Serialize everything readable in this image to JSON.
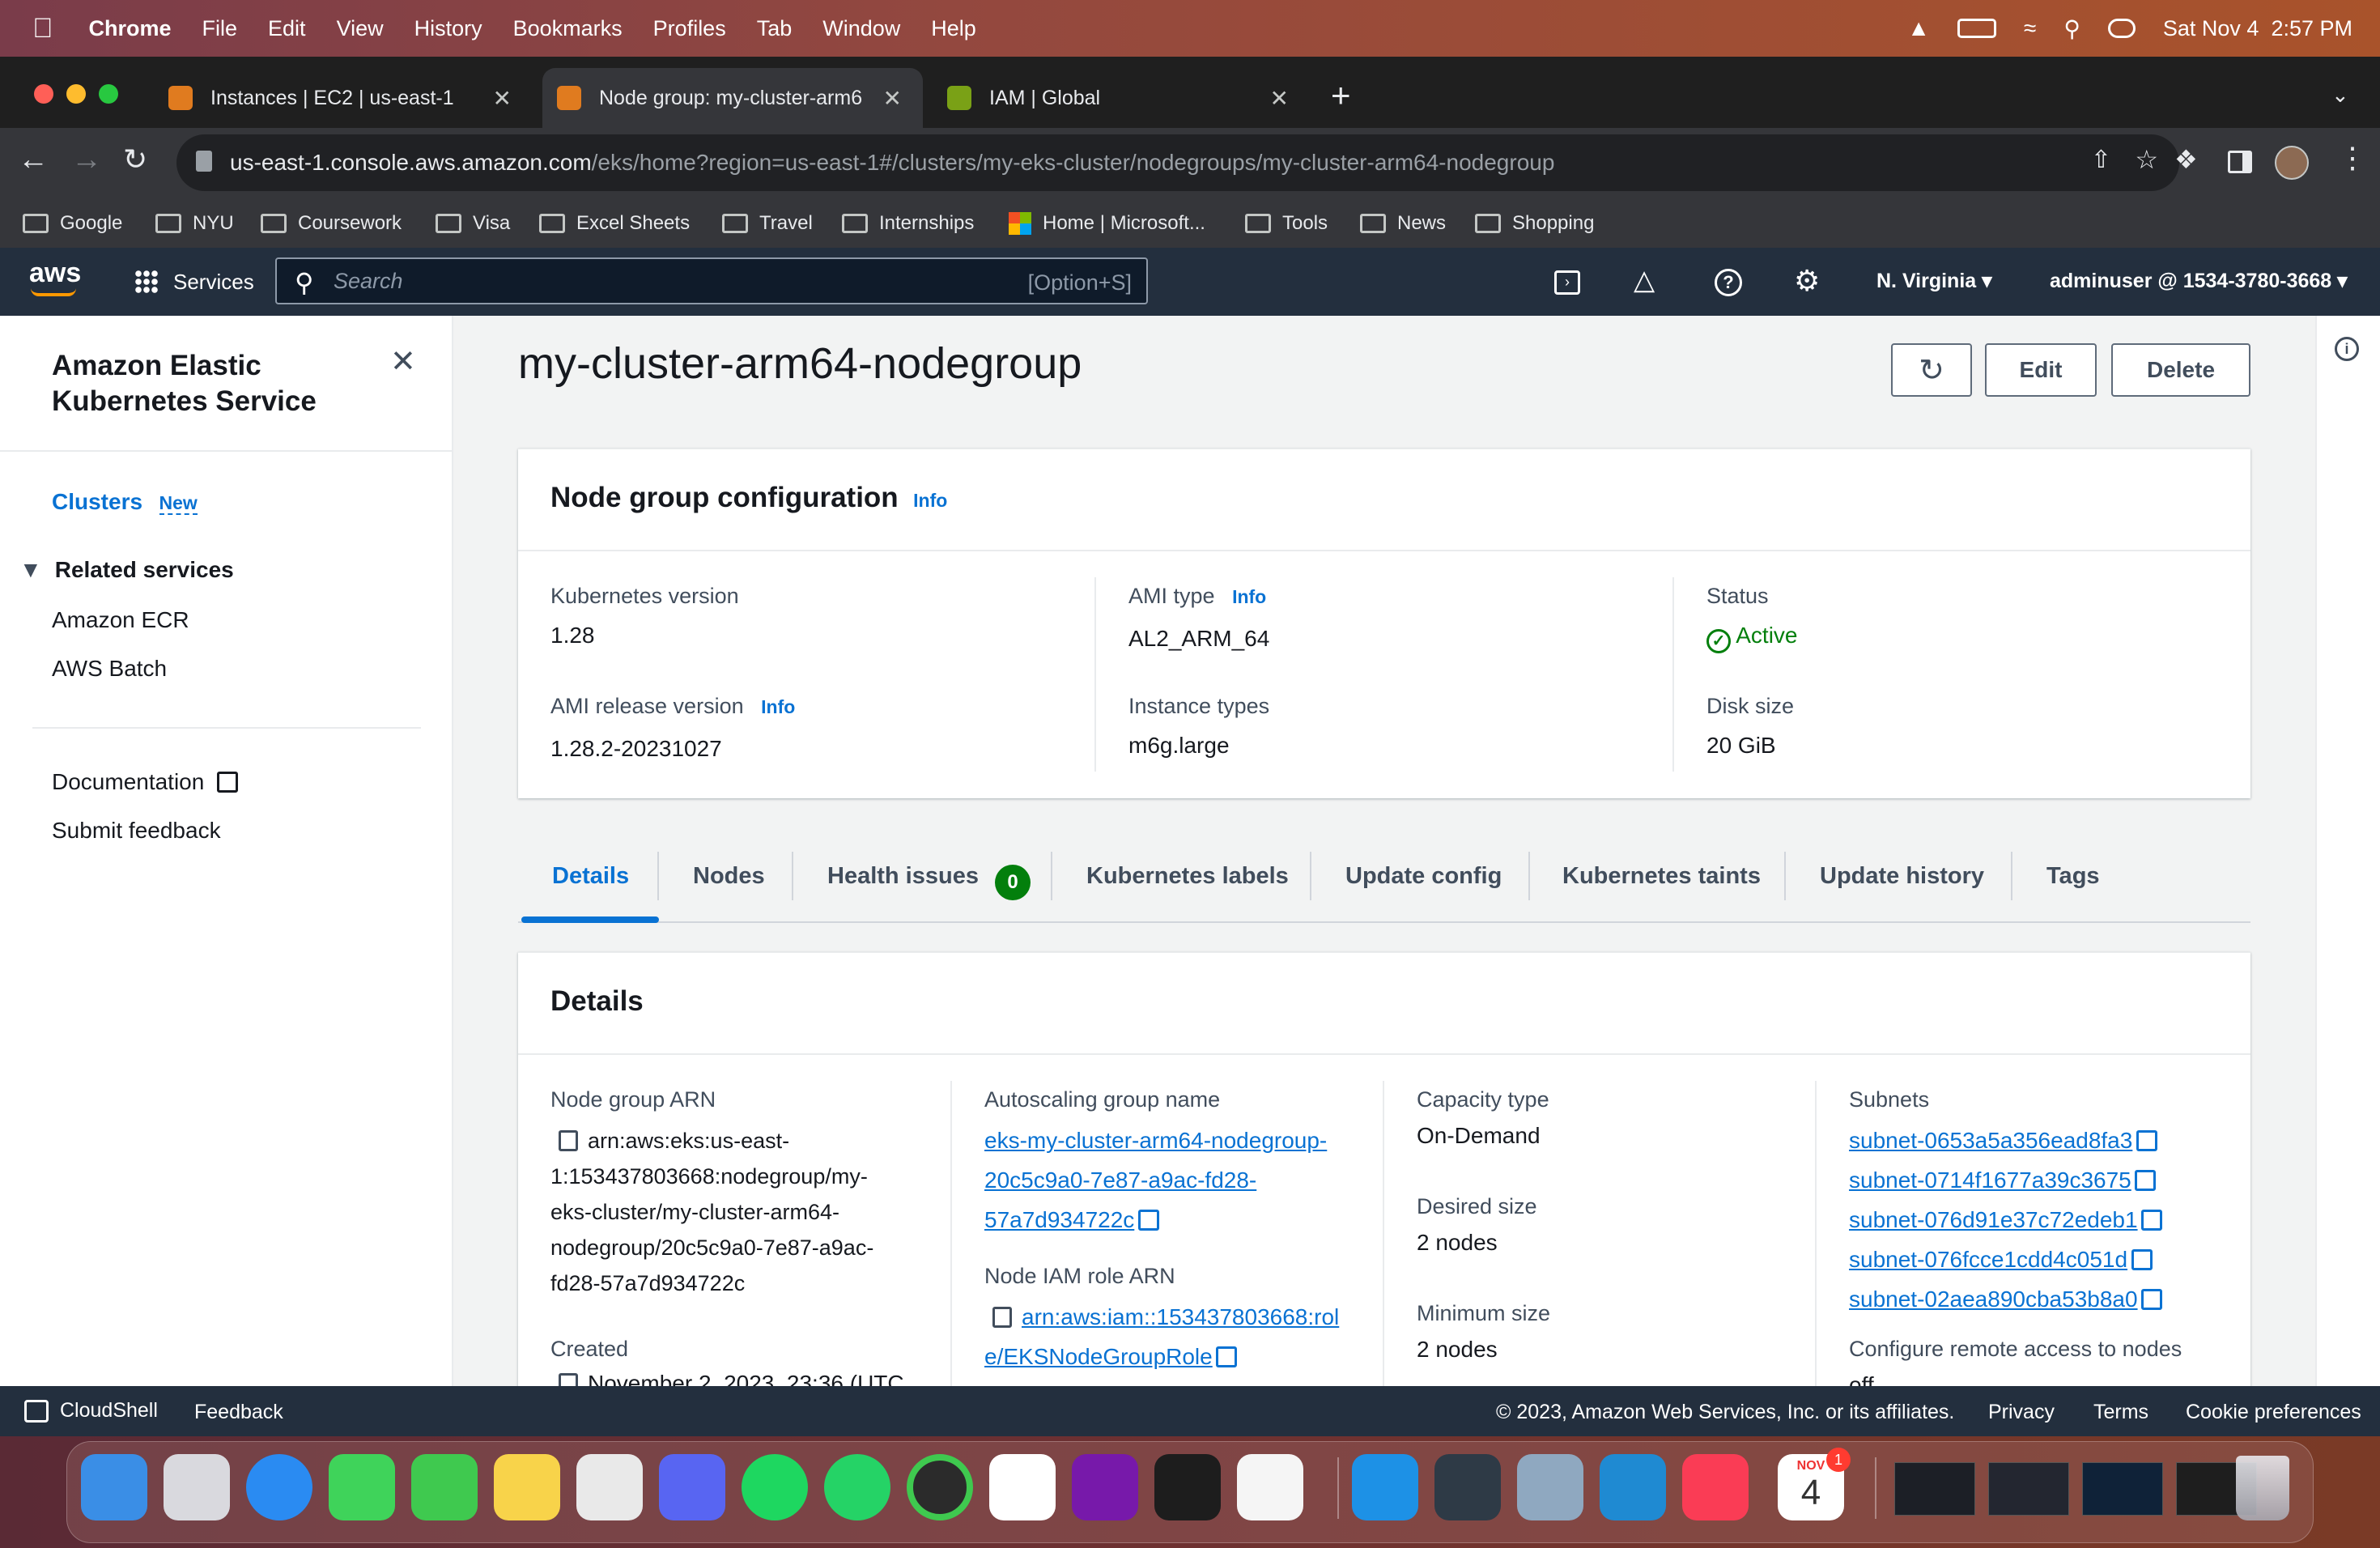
{
  "menubar": {
    "app": "Chrome",
    "items": [
      "File",
      "Edit",
      "View",
      "History",
      "Bookmarks",
      "Profiles",
      "Tab",
      "Window",
      "Help"
    ],
    "datetime": "Sat Nov 4  2:57 PM"
  },
  "browser": {
    "tabs": [
      {
        "title": "Instances | EC2 | us-east-1",
        "favicon_color": "#e07b1f"
      },
      {
        "title": "Node group: my-cluster-arm6",
        "favicon_color": "#e07b1f"
      },
      {
        "title": "IAM | Global",
        "favicon_color": "#7aa116"
      }
    ],
    "url_domain": "us-east-1.console.aws.amazon.com",
    "url_path": "/eks/home?region=us-east-1#/clusters/my-eks-cluster/nodegroups/my-cluster-arm64-nodegroup",
    "bookmarks": [
      "Google",
      "NYU",
      "Coursework",
      "Visa",
      "Excel Sheets",
      "Travel",
      "Internships",
      "Home | Microsoft...",
      "Tools",
      "News",
      "Shopping"
    ]
  },
  "awsnav": {
    "logo": "aws",
    "services": "Services",
    "search_placeholder": "Search",
    "search_shortcut": "[Option+S]",
    "region": "N. Virginia",
    "account": "adminuser @ 1534-3780-3668"
  },
  "sidebar": {
    "title": "Amazon Elastic Kubernetes Service",
    "clusters": "Clusters",
    "new_badge": "New",
    "related": "Related services",
    "related_items": [
      "Amazon ECR",
      "AWS Batch"
    ],
    "documentation": "Documentation",
    "feedback": "Submit feedback"
  },
  "page": {
    "title": "my-cluster-arm64-nodegroup",
    "edit": "Edit",
    "delete": "Delete"
  },
  "config": {
    "heading": "Node group configuration",
    "info": "Info",
    "k8s_version_label": "Kubernetes version",
    "k8s_version": "1.28",
    "ami_type_label": "AMI type",
    "ami_type": "AL2_ARM_64",
    "status_label": "Status",
    "status": "Active",
    "ami_release_label": "AMI release version",
    "ami_release": "1.28.2-20231027",
    "instance_types_label": "Instance types",
    "instance_types": "m6g.large",
    "disk_size_label": "Disk size",
    "disk_size": "20 GiB"
  },
  "tabs": {
    "items": [
      "Details",
      "Nodes",
      "Health issues",
      "Kubernetes labels",
      "Update config",
      "Kubernetes taints",
      "Update history",
      "Tags"
    ],
    "health_count": "0"
  },
  "details": {
    "heading": "Details",
    "arn_label": "Node group ARN",
    "arn_lines": [
      "arn:aws:eks:us-east-",
      "1:153437803668:nodegroup/my-",
      "eks-cluster/my-cluster-arm64-",
      "nodegroup/20c5c9a0-7e87-a9ac-",
      "fd28-57a7d934722c"
    ],
    "created_label": "Created",
    "created_value": "November 2, 2023, 23:36 (UTC",
    "asg_label": "Autoscaling group name",
    "asg_lines": [
      "eks-my-cluster-arm64-nodegroup-",
      "20c5c9a0-7e87-a9ac-fd28-",
      "57a7d934722c"
    ],
    "role_label": "Node IAM role ARN",
    "role_lines": [
      "arn:aws:iam::153437803668:rol",
      "e/EKSNodeGroupRole"
    ],
    "capacity_label": "Capacity type",
    "capacity": "On-Demand",
    "desired_label": "Desired size",
    "desired": "2 nodes",
    "min_label": "Minimum size",
    "min": "2 nodes",
    "subnets_label": "Subnets",
    "subnets": [
      "subnet-0653a5a356ead8fa3",
      "subnet-0714f1677a39c3675",
      "subnet-076d91e37c72edeb1",
      "subnet-076fcce1cdd4c051d",
      "subnet-02aea890cba53b8a0"
    ],
    "remote_label": "Configure remote access to nodes",
    "remote_value": "off"
  },
  "footer": {
    "cloudshell": "CloudShell",
    "feedback": "Feedback",
    "copyright": "© 2023, Amazon Web Services, Inc. or its affiliates.",
    "privacy": "Privacy",
    "terms": "Terms",
    "cookies": "Cookie preferences"
  },
  "dock": {
    "calendar_month": "NOV",
    "calendar_day": "4",
    "calendar_badge": "1",
    "apps": [
      {
        "name": "finder",
        "color": "#3a8ee6"
      },
      {
        "name": "launchpad",
        "color": "#d9d9de"
      },
      {
        "name": "safari",
        "color": "#2a8bf2"
      },
      {
        "name": "messages",
        "color": "#3fd35a"
      },
      {
        "name": "facetime",
        "color": "#3fc94f"
      },
      {
        "name": "notes",
        "color": "#f8d34a"
      },
      {
        "name": "chrome",
        "color": "#e9e9e9"
      },
      {
        "name": "discord",
        "color": "#5865f2"
      },
      {
        "name": "spotify",
        "color": "#1ed760"
      },
      {
        "name": "whatsapp",
        "color": "#25d366"
      },
      {
        "name": "circle-app",
        "color": "#2b2b2b"
      },
      {
        "name": "slack",
        "color": "#ffffff"
      },
      {
        "name": "onenote",
        "color": "#7719aa"
      },
      {
        "name": "terminal",
        "color": "#1d1d1d"
      },
      {
        "name": "textedit",
        "color": "#f5f5f5"
      },
      {
        "name": "docker",
        "color": "#1d91e6"
      },
      {
        "name": "xcode-like",
        "color": "#2e3a46"
      },
      {
        "name": "preview",
        "color": "#8fa8c0"
      },
      {
        "name": "vscode",
        "color": "#1f8ad2"
      },
      {
        "name": "music",
        "color": "#fa3c55"
      },
      {
        "name": "calendar",
        "color": "#ffffff"
      }
    ]
  }
}
